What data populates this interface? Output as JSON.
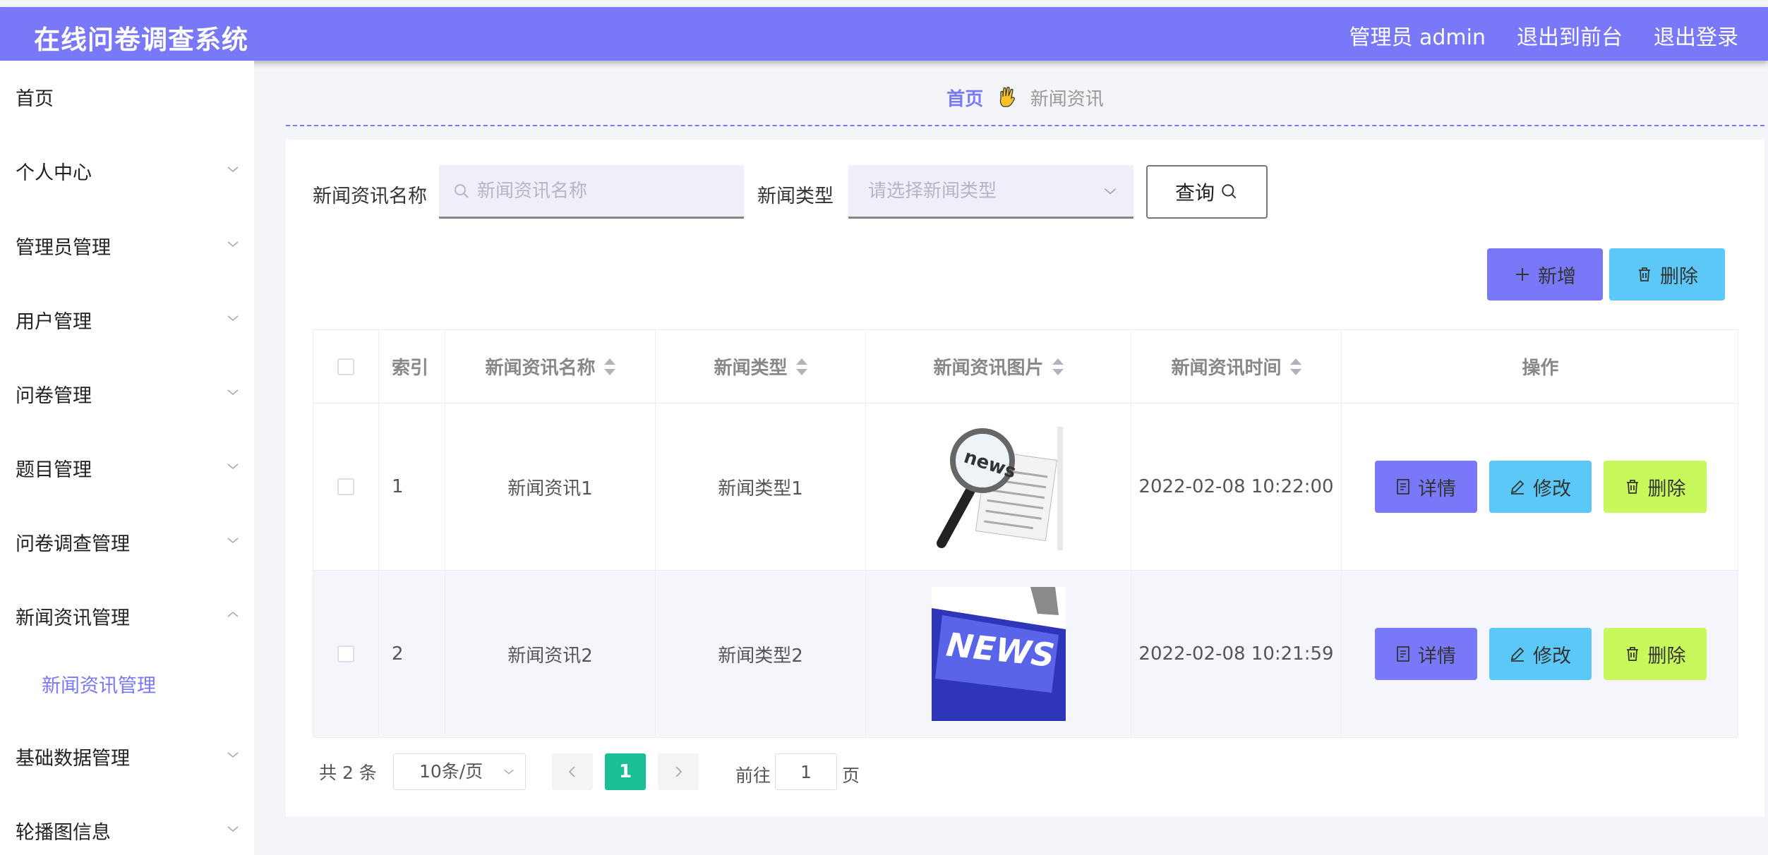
{
  "header": {
    "title": "在线问卷调查系统",
    "admin_label": "管理员 admin",
    "frontend_link": "退出到前台",
    "logout_link": "退出登录"
  },
  "sidebar": {
    "items": [
      {
        "label": "首页"
      },
      {
        "label": "个人中心"
      },
      {
        "label": "管理员管理"
      },
      {
        "label": "用户管理"
      },
      {
        "label": "问卷管理"
      },
      {
        "label": "题目管理"
      },
      {
        "label": "问卷调查管理"
      },
      {
        "label": "新闻资讯管理"
      },
      {
        "label": "基础数据管理"
      },
      {
        "label": "轮播图信息"
      }
    ],
    "sub_item": "新闻资讯管理"
  },
  "breadcrumb": {
    "home": "首页",
    "current": "新闻资讯"
  },
  "search": {
    "name_label": "新闻资讯名称",
    "name_placeholder": "新闻资讯名称",
    "type_label": "新闻类型",
    "type_placeholder": "请选择新闻类型",
    "query_button": "查询"
  },
  "actions": {
    "add_label": "新增",
    "delete_label": "删除"
  },
  "table": {
    "headers": [
      "索引",
      "新闻资讯名称",
      "新闻类型",
      "新闻资讯图片",
      "新闻资讯时间",
      "操作"
    ],
    "rows": [
      {
        "index": "1",
        "name": "新闻资讯1",
        "type": "新闻类型1",
        "image": "news-magnifier-image",
        "time": "2022-02-08 10:22:00"
      },
      {
        "index": "2",
        "name": "新闻资讯2",
        "type": "新闻类型2",
        "image": "news-key-image",
        "time": "2022-02-08 10:21:59"
      }
    ],
    "ops": {
      "detail": "详情",
      "edit": "修改",
      "delete": "删除"
    }
  },
  "pagination": {
    "total": "共 2 条",
    "page_size": "10条/页",
    "current_page": "1",
    "goto_prefix": "前往",
    "goto_value": "1",
    "goto_suffix": "页"
  },
  "colors": {
    "primary": "#7878f8",
    "info": "#5cc8f7",
    "lime": "#c9f85c",
    "page_active": "#1bbf95"
  }
}
